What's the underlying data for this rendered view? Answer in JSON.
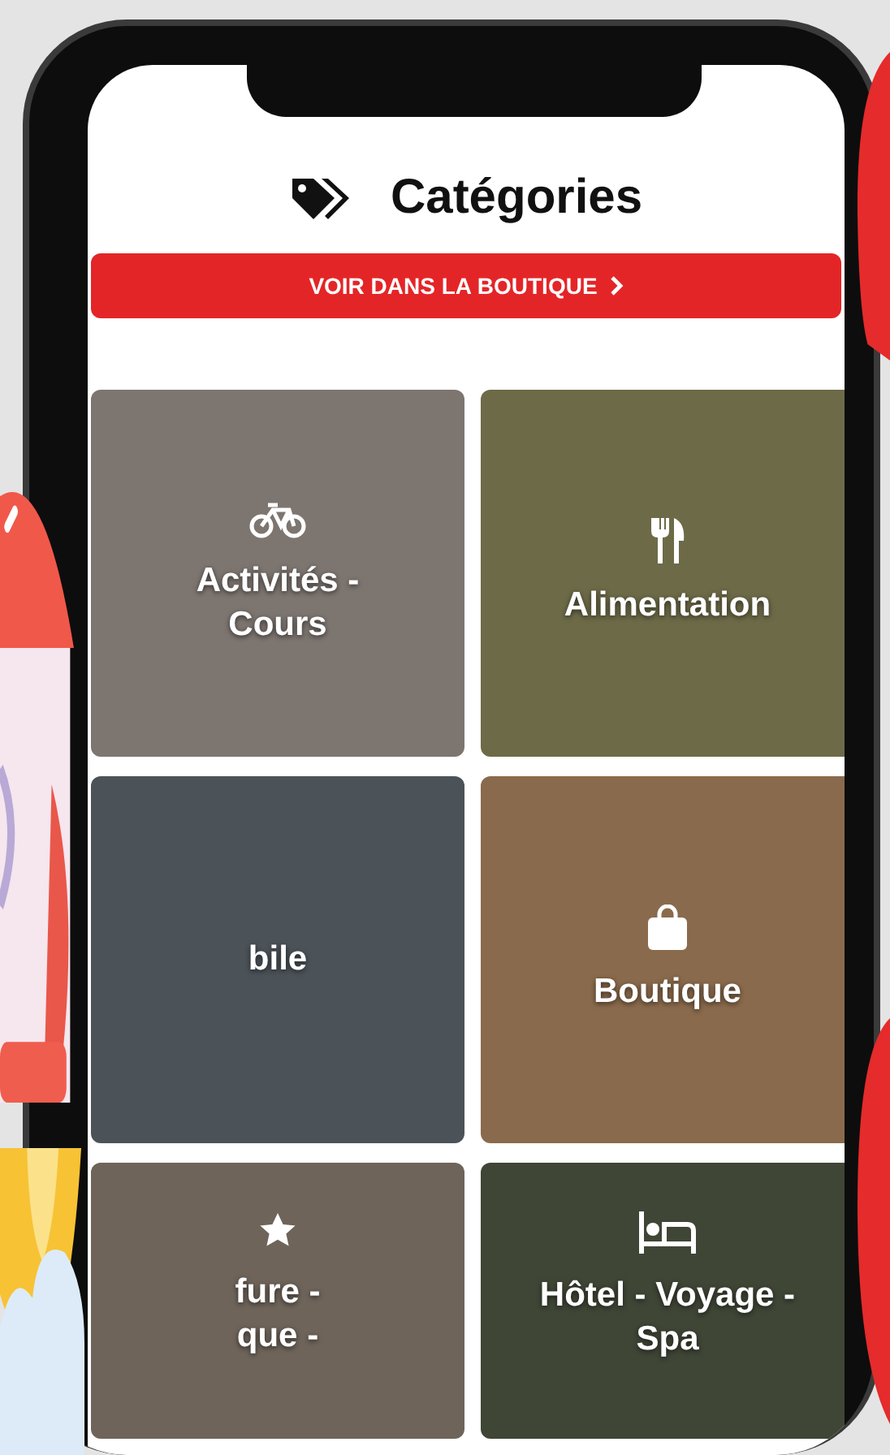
{
  "header": {
    "title": "Catégories"
  },
  "shop_button": {
    "label": "VOIR DANS LA BOUTIQUE"
  },
  "categories": [
    {
      "label": "Activités - Cours",
      "kind": "bike"
    },
    {
      "label": "Alimentation",
      "kind": "utensils"
    },
    {
      "label": "bile",
      "kind": "none"
    },
    {
      "label": "Boutique",
      "kind": "bag"
    },
    {
      "label": "fure - que -",
      "kind": "star"
    },
    {
      "label": "Hôtel - Voyage - Spa",
      "kind": "bed"
    }
  ]
}
